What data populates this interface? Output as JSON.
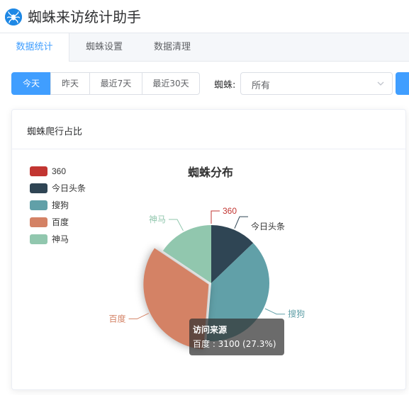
{
  "app": {
    "title": "蜘蛛来访统计助手"
  },
  "tabs": [
    {
      "label": "数据统计",
      "active": true
    },
    {
      "label": "蜘蛛设置",
      "active": false
    },
    {
      "label": "数据清理",
      "active": false
    }
  ],
  "toolbar": {
    "ranges": [
      {
        "label": "今天",
        "active": true
      },
      {
        "label": "昨天",
        "active": false
      },
      {
        "label": "最近7天",
        "active": false
      },
      {
        "label": "最近30天",
        "active": false
      }
    ],
    "spider_label": "蜘蛛:",
    "spider_select_value": "所有"
  },
  "card": {
    "title": "蜘蛛爬行占比"
  },
  "chart_data": {
    "type": "pie",
    "title": "蜘蛛分布",
    "legend_position": "top-left",
    "series": [
      {
        "name": "360",
        "value": 0,
        "color": "#c23531"
      },
      {
        "name": "今日头条",
        "value": 1200,
        "color": "#2f4554"
      },
      {
        "name": "搜狗",
        "value": 3600,
        "color": "#61a0a8"
      },
      {
        "name": "百度",
        "value": 3100,
        "color": "#d48265"
      },
      {
        "name": "神马",
        "value": 1460,
        "color": "#91c7ae"
      }
    ],
    "tooltip": {
      "title": "访问来源",
      "text": "百度 : 3100 (27.3%)"
    }
  }
}
